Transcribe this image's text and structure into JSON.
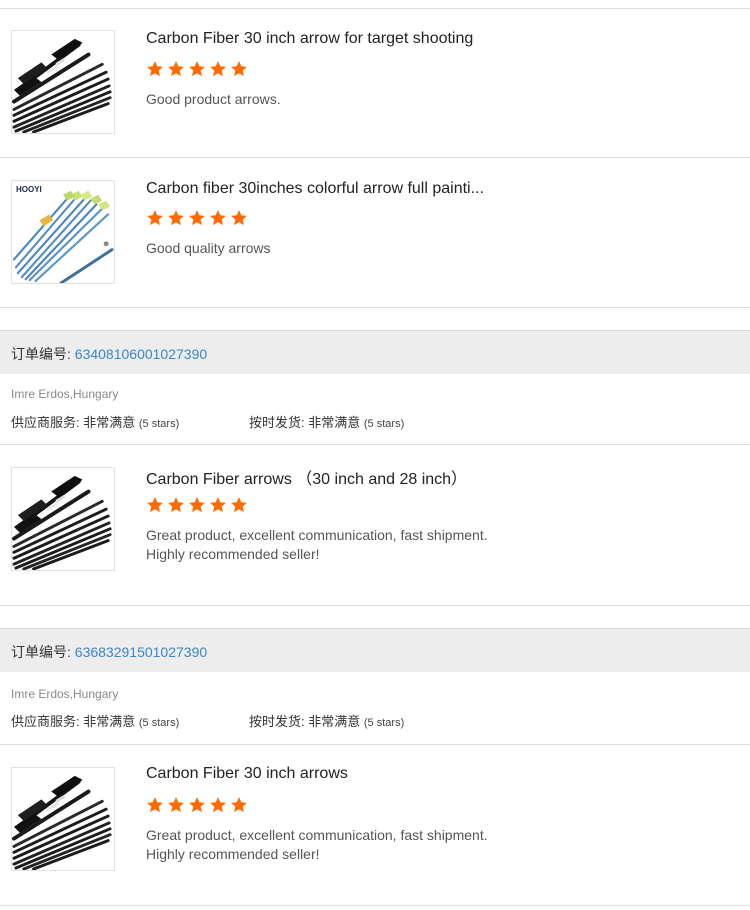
{
  "colors": {
    "star": "#ff6a00",
    "link": "#3b86c8",
    "band": "#ededed"
  },
  "products": [
    {
      "title": "Carbon Fiber 30 inch arrow for target shooting",
      "rating": 5,
      "review": "Good product arrows.",
      "image": "black-arrows"
    },
    {
      "title": "Carbon fiber 30inches colorful arrow full painti...",
      "rating": 5,
      "review": "Good quality arrows",
      "image": "blue-arrows"
    }
  ],
  "orders": [
    {
      "order_label": "订单编号:",
      "order_number": "63408106001027390",
      "buyer": "Imre Erdos,Hungary",
      "supplier_service_label": "供应商服务:",
      "supplier_service_value": "非常满意",
      "supplier_service_stars": "(5 stars)",
      "shipping_label": "按时发货:",
      "shipping_value": "非常满意",
      "shipping_stars": "(5 stars)",
      "product": {
        "title": "Carbon Fiber arrows （30 inch and 28 inch）",
        "rating": 5,
        "review_line1": "Great product, excellent communication, fast shipment.",
        "review_line2": "Highly recommended seller!",
        "image": "black-arrows"
      }
    },
    {
      "order_label": "订单编号:",
      "order_number": "63683291501027390",
      "buyer": "Imre Erdos,Hungary",
      "supplier_service_label": "供应商服务:",
      "supplier_service_value": "非常满意",
      "supplier_service_stars": "(5 stars)",
      "shipping_label": "按时发货:",
      "shipping_value": "非常满意",
      "shipping_stars": "(5 stars)",
      "product": {
        "title": "Carbon Fiber 30 inch arrows",
        "rating": 5,
        "review_line1": "Great product, excellent communication, fast shipment.",
        "review_line2": "Highly recommended seller!",
        "image": "black-arrows"
      }
    }
  ],
  "brand_on_image": "HOOYI"
}
